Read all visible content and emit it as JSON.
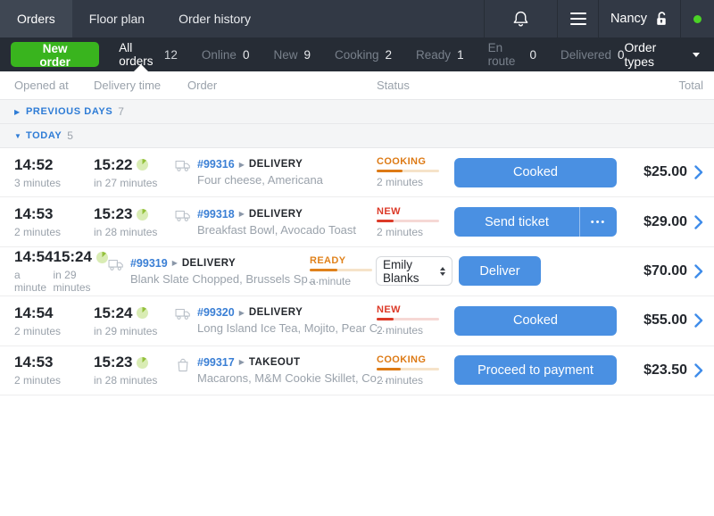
{
  "topbar": {
    "tabs": [
      {
        "label": "Orders"
      },
      {
        "label": "Floor plan"
      },
      {
        "label": "Order history"
      }
    ],
    "user_name": "Nancy"
  },
  "filterbar": {
    "new_order": "New order",
    "filters": [
      {
        "label": "All orders",
        "count": "12"
      },
      {
        "label": "Online",
        "count": "0"
      },
      {
        "label": "New",
        "count": "9"
      },
      {
        "label": "Cooking",
        "count": "2"
      },
      {
        "label": "Ready",
        "count": "1"
      },
      {
        "label": "En route",
        "count": "0"
      },
      {
        "label": "Delivered",
        "count": "0"
      }
    ],
    "order_types": "Order types"
  },
  "table": {
    "headers": {
      "opened": "Opened at",
      "delivery": "Delivery time",
      "order": "Order",
      "status": "Status",
      "total": "Total"
    },
    "sections": {
      "previous": {
        "label": "PREVIOUS DAYS",
        "count": "7"
      },
      "today": {
        "label": "TODAY",
        "count": "5"
      }
    },
    "rows": [
      {
        "opened_time": "14:52",
        "opened_ago": "3 minutes",
        "delivery_time": "15:22",
        "delivery_in": "in 27 minutes",
        "number": "#99316",
        "type": "DELIVERY",
        "items": "Four cheese, Americana",
        "status": {
          "label": "COOKING",
          "time": "2 minutes",
          "color": "#dd7a15",
          "track": "#f6e3c9",
          "progress": "42%"
        },
        "action": {
          "label": "Cooked"
        },
        "total": "$25.00"
      },
      {
        "opened_time": "14:53",
        "opened_ago": "2 minutes",
        "delivery_time": "15:23",
        "delivery_in": "in 28 minutes",
        "number": "#99318",
        "type": "DELIVERY",
        "items": "Breakfast Bowl, Avocado Toast",
        "status": {
          "label": "NEW",
          "time": "2 minutes",
          "color": "#dc3a28",
          "track": "#f6d8d5",
          "progress": "27%"
        },
        "action": {
          "label": "Send ticket",
          "more": "•••"
        },
        "total": "$29.00"
      },
      {
        "opened_time": "14:54",
        "opened_ago": "a minute",
        "delivery_time": "15:24",
        "delivery_in": "in 29 minutes",
        "number": "#99319",
        "type": "DELIVERY",
        "items": "Blank Slate Chopped, Brussels Sp…",
        "status": {
          "label": "READY",
          "time": "a minute",
          "color": "#e0821c",
          "track": "#f6e3c9",
          "progress": "45%"
        },
        "action": {
          "select_value": "Emily Blanks",
          "label": "Deliver"
        },
        "total": "$70.00"
      },
      {
        "opened_time": "14:54",
        "opened_ago": "2 minutes",
        "delivery_time": "15:24",
        "delivery_in": "in 29 minutes",
        "number": "#99320",
        "type": "DELIVERY",
        "items": "Long Island Ice Tea, Mojito, Pear C…",
        "status": {
          "label": "NEW",
          "time": "2 minutes",
          "color": "#dc3a28",
          "track": "#f6d8d5",
          "progress": "27%"
        },
        "action": {
          "label": "Cooked"
        },
        "total": "$55.00"
      },
      {
        "opened_time": "14:53",
        "opened_ago": "2 minutes",
        "delivery_time": "15:23",
        "delivery_in": "in 28 minutes",
        "number": "#99317",
        "type": "TAKEOUT",
        "items": "Macarons, M&M Cookie Skillet, Co…",
        "status": {
          "label": "COOKING",
          "time": "2 minutes",
          "color": "#dd7a15",
          "track": "#f6e3c9",
          "progress": "38%"
        },
        "action": {
          "label": "Proceed to payment"
        },
        "total": "$23.50"
      }
    ]
  },
  "colors": {
    "topbar_bg": "#323945",
    "filterbar_bg": "#262c35",
    "accent_blue": "#4a90e2",
    "link_blue": "#3a7fd5",
    "green_button": "#39b41e",
    "online_green": "#4bd226",
    "status_cooking": "#dd7a15",
    "status_new": "#dc3a28",
    "status_ready": "#e0821c"
  }
}
